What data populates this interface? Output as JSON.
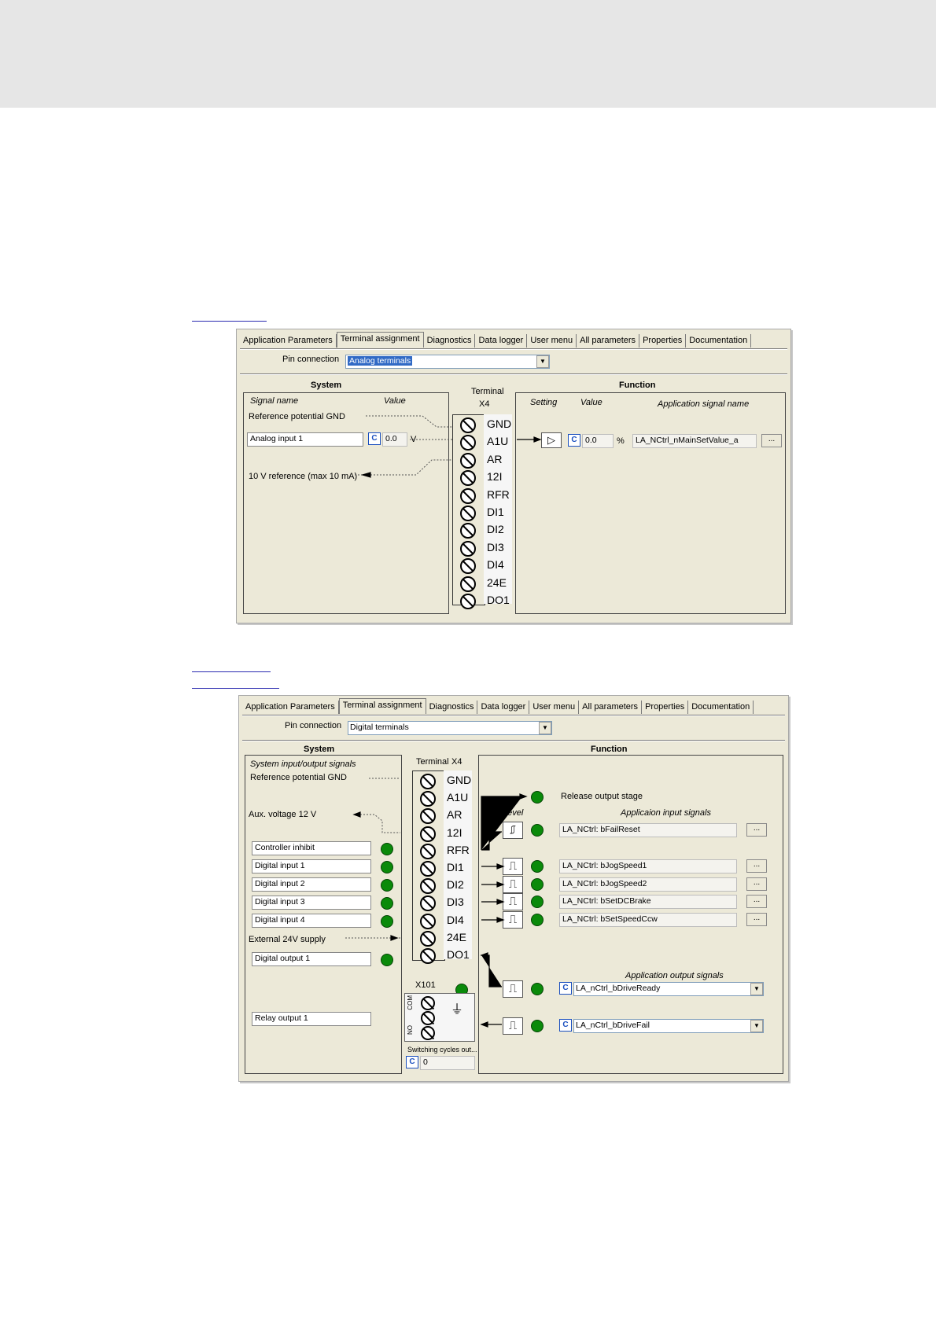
{
  "tabs": [
    {
      "label": "Application Parameters",
      "active": false
    },
    {
      "label": "Terminal assignment",
      "active": true
    },
    {
      "label": "Diagnostics",
      "active": false
    },
    {
      "label": "Data logger",
      "active": false
    },
    {
      "label": "User menu",
      "active": false
    },
    {
      "label": "All parameters",
      "active": false
    },
    {
      "label": "Properties",
      "active": false
    },
    {
      "label": "Documentation",
      "active": false
    }
  ],
  "pins": [
    "GND",
    "A1U",
    "AR",
    "12I",
    "RFR",
    "DI1",
    "DI2",
    "DI3",
    "DI4",
    "24E",
    "DO1"
  ],
  "panel1": {
    "pin_connection_label": "Pin connection",
    "pin_connection_value": "Analog terminals",
    "system_title": "System",
    "function_title": "Function",
    "terminal_label": "Terminal",
    "terminal_x": "X4",
    "col_signal_name": "Signal name",
    "col_value": "Value",
    "ref_gnd": "Reference potential GND",
    "analog_input_name": "Analog input 1",
    "analog_value": "0.0",
    "analog_unit": "V",
    "ref_10v": "10 V reference (max 10 mA)",
    "col_setting": "Setting",
    "col_fn_value": "Value",
    "col_app_signal": "Application signal name",
    "fn_value": "0.0",
    "fn_unit": "%",
    "fn_signal": "LA_NCtrl_nMainSetValue_a",
    "c_label": "C",
    "dots": "..."
  },
  "panel2": {
    "pin_connection_label": "Pin connection",
    "pin_connection_value": "Digital terminals",
    "system_title": "System",
    "function_title": "Function",
    "terminal_label": "Terminal",
    "terminal_x": "X4",
    "sys_io_signals": "System input/output signals",
    "ref_gnd": "Reference potential GND",
    "aux_voltage": "Aux. voltage 12 V",
    "inputs": [
      "Controller inhibit",
      "Digital input 1",
      "Digital input 2",
      "Digital input 3",
      "Digital input 4"
    ],
    "ext_supply": "External 24V supply",
    "digital_output": "Digital output 1",
    "relay_output": "Relay output 1",
    "x101": "X101",
    "relay_com": "COM",
    "relay_no": "NO",
    "switching_cycles": "Switching cycles out...",
    "switching_value": "0",
    "release_output": "Release output stage",
    "level": "Level",
    "app_input_signals": "Applicaion input signals",
    "input_signals": [
      "LA_NCtrl: bFailReset",
      "LA_NCtrl: bJogSpeed1",
      "LA_NCtrl: bJogSpeed2",
      "LA_NCtrl: bSetDCBrake",
      "LA_NCtrl: bSetSpeedCcw"
    ],
    "app_output_signals": "Application output signals",
    "output_signals": [
      "LA_nCtrl_bDriveReady",
      "LA_nCtrl_bDriveFail"
    ],
    "c_label": "C",
    "dots": "..."
  },
  "colors": {
    "led": "#0a8a0a",
    "panel_bg": "#ece9d8",
    "select_highlight": "#316ac5",
    "c_button": "#1a4fbf"
  }
}
